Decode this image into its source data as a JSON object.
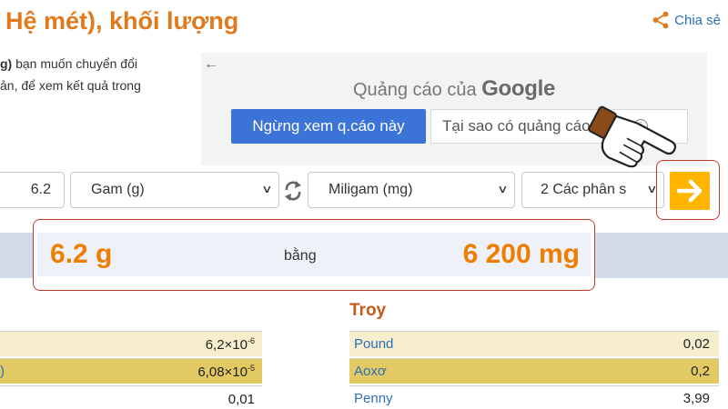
{
  "header": {
    "title": "Hệ mét), khối lượng",
    "share_label": "Chia sẻ"
  },
  "description": {
    "line1_bold": "g)",
    "line1_text": " bạn muốn chuyển đổi",
    "line2_text": "ản, để xem kết quả trong"
  },
  "ad": {
    "back_glyph": "←",
    "label_prefix": "Quảng cáo của ",
    "label_brand": "Google",
    "stop_button": "Ngừng xem q.cáo này",
    "why_button": "Tại sao có quảng cáo này?",
    "info_glyph": "i"
  },
  "converter": {
    "value": "6.2",
    "from_unit": "Gam (g)",
    "to_unit": "Miligam (mg)",
    "decimals": "2 Các phân s",
    "go_icon": "arrow-right-icon"
  },
  "result": {
    "left": "6.2 g",
    "middle": "bằng",
    "right": "6 200 mg"
  },
  "left_table": {
    "rows": [
      {
        "name": "",
        "mantissa": "6,2×10",
        "exp": "-6",
        "style": "light"
      },
      {
        "name": ")",
        "mantissa": "6,08×10",
        "exp": "-5",
        "style": "dark"
      },
      {
        "name": "",
        "mantissa": "0,01",
        "exp": "",
        "style": "white"
      }
    ]
  },
  "troy": {
    "title": "Troy",
    "rows": [
      {
        "name": "Pound",
        "value": "0,02",
        "style": "light"
      },
      {
        "name": "Aoxơ",
        "value": "0,2",
        "style": "dark"
      },
      {
        "name": "Penny",
        "value": "3,99",
        "style": "white"
      }
    ]
  },
  "colors": {
    "accent_orange": "#ef7d00",
    "link_blue": "#2c6fbb",
    "go_button": "#ffb500",
    "highlight_border": "#c0392b"
  }
}
